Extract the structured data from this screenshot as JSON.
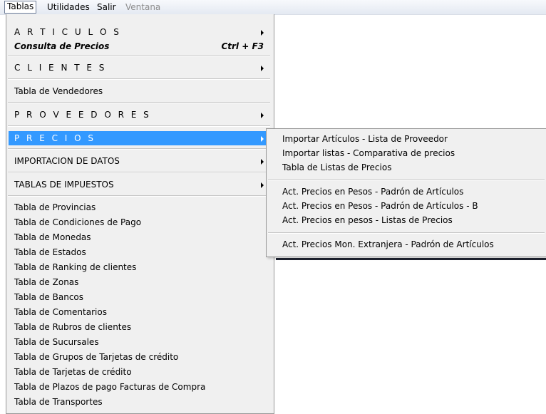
{
  "menubar": {
    "items": [
      {
        "label": "Tablas"
      },
      {
        "label": "Utilidades"
      },
      {
        "label": "Salir"
      },
      {
        "label": "Ventana"
      }
    ]
  },
  "tablas_menu": {
    "articulos": "A R T I C U L O S",
    "consulta_precios": "Consulta de Precios",
    "consulta_precios_shortcut": "Ctrl + F3",
    "clientes": "C L I E N T E S",
    "tabla_vendedores": "Tabla de Vendedores",
    "proveedores": "P R O V E E D O R E S",
    "precios": "P R E C I O S",
    "importacion_datos": "IMPORTACION DE DATOS",
    "tablas_impuestos": "TABLAS DE IMPUESTOS",
    "tables": [
      "Tabla de Provincias",
      "Tabla de Condiciones de Pago",
      "Tabla de Monedas",
      "Tabla de Estados",
      "Tabla de Ranking de clientes",
      "Tabla de Zonas",
      "Tabla de Bancos",
      "Tabla de Comentarios",
      "Tabla de Rubros de clientes",
      "Tabla de Sucursales",
      "Tabla de Grupos de Tarjetas de crédito",
      "Tabla de Tarjetas de crédito",
      "Tabla de Plazos de pago Facturas de Compra",
      "Tabla de Transportes"
    ]
  },
  "precios_submenu": {
    "items": [
      "Importar Artículos - Lista de Proveedor",
      "Importar listas - Comparativa de precios",
      "Tabla de Listas de Precios",
      "Act. Precios en Pesos - Padrón de Artículos",
      "Act. Precios en Pesos - Padrón de Artículos - B",
      "Act. Precios en pesos - Listas de Precios",
      "Act. Precios Mon. Extranjera - Padrón de Artículos"
    ]
  },
  "colors": {
    "selection": "#3399ff",
    "menu_bg": "#f0f0f0"
  }
}
